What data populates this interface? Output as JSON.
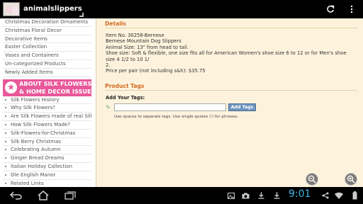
{
  "app": {
    "title": "animalslippers"
  },
  "sidebar": {
    "links": [
      "Christmas Decoration Ornaments",
      "Christmas Floral Decor",
      "Decorative Items",
      "Easter Collection",
      "Vases and Containers",
      "Un-categorized Products",
      "Newly Added Items"
    ],
    "banner": {
      "line1": "ABOUT SILK FLOWERS",
      "line2": "& HOME DECOR ISSUE"
    },
    "sublinks": [
      "Silk Flowers History",
      "Why Silk Flowers?",
      "Are Silk Flowers made of real Silk?",
      "How Silk Flowers Made?",
      "Silk-Flowers-for-Christmas",
      "Silk Berry Christmas",
      "Celebrating Autumn",
      "Ginger Bread Dreams",
      "Italian Holiday Collection",
      "Ole English Manor",
      "Related Links"
    ]
  },
  "details": {
    "heading": "Details",
    "item_no": "Item No. 30258-Bernese",
    "name": "Bernese Mountain Dog Slippers",
    "animal_size": "Animal Size: 13\" from head to tail.",
    "shoe_size": "Shoe size: Soft & flexible, one size fits all for American Women's shoe size 6 to 12 or for Men's shoe size 4 1/2 to 10 1/",
    "shoe_size_cont": "2.",
    "price": "Price per pair (not including s&h): $35.75"
  },
  "tags": {
    "heading": "Product Tags",
    "add_label": "Add Your Tags:",
    "input_value": "",
    "button_label": "Add Tags",
    "hint": "Use spaces to separate tags. Use single quotes (') for phrases."
  },
  "statusbar": {
    "time": "9:01"
  }
}
